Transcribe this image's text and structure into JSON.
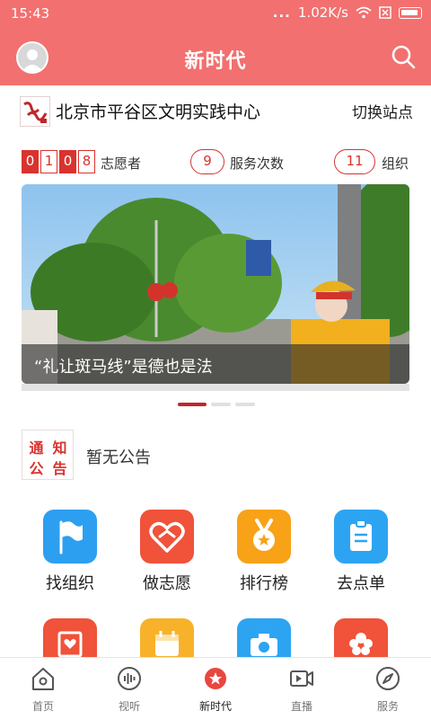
{
  "status_bar": {
    "time": "15:43",
    "dots": "...",
    "net_speed": "1.02K/s"
  },
  "header": {
    "title": "新时代"
  },
  "site": {
    "name": "北京市平谷区文明实践中心",
    "switch_label": "切换站点",
    "logo_text": "新时代"
  },
  "stats": {
    "volunteer_digits": [
      "0",
      "1",
      "0",
      "8"
    ],
    "volunteer_label": "志愿者",
    "service_count": "9",
    "service_label": "服务次数",
    "org_count": "11",
    "org_label": "组织"
  },
  "banner": {
    "caption": "“礼让斑马线”是德也是法",
    "page_count": 3,
    "active_page": 1
  },
  "notice": {
    "badge_chars": [
      "通",
      "知",
      "公",
      "告"
    ],
    "text": "暂无公告"
  },
  "grid": [
    {
      "label": "找组织",
      "icon": "flag-icon",
      "color": "#2d9ff0"
    },
    {
      "label": "做志愿",
      "icon": "heart-icon",
      "color": "#f0523a"
    },
    {
      "label": "排行榜",
      "icon": "medal-icon",
      "color": "#f8a218"
    },
    {
      "label": "去点单",
      "icon": "clipboard-icon",
      "color": "#2da4f2"
    }
  ],
  "grid_row2": [
    {
      "icon": "heart-card-icon",
      "color": "#f0523a"
    },
    {
      "icon": "calendar-icon",
      "color": "#f8b22a"
    },
    {
      "icon": "camera-icon",
      "color": "#2da4f2"
    },
    {
      "icon": "flower-icon",
      "color": "#f0523a"
    }
  ],
  "tabs": [
    {
      "label": "首页",
      "icon": "home-icon"
    },
    {
      "label": "视听",
      "icon": "audio-icon"
    },
    {
      "label": "新时代",
      "icon": "star-icon"
    },
    {
      "label": "直播",
      "icon": "video-icon"
    },
    {
      "label": "服务",
      "icon": "compass-icon"
    }
  ],
  "active_tab": 2,
  "colors": {
    "header": "#f2706f",
    "accent": "#d9332f"
  }
}
